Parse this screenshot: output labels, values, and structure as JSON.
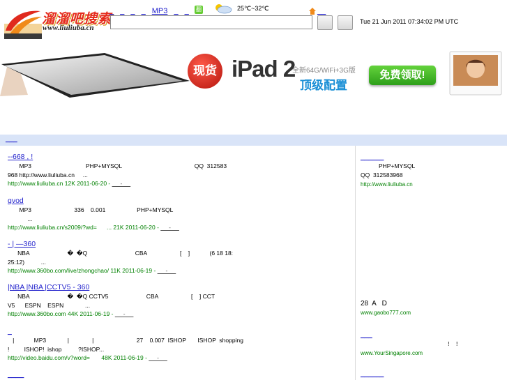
{
  "header": {
    "logo_text": "溜溜吧搜索",
    "logo_url": "www.liuliuba.cn",
    "nav": [
      "_",
      "_",
      "_",
      "_",
      "MP3",
      "_",
      "_"
    ],
    "weather_badge": "翻",
    "temperature": "25℃~32℃",
    "home_link": "__",
    "datetime": "Tue 21 Jun 2011 07:34:02 PM UTC",
    "search_value": ""
  },
  "banner": {
    "badge": "现货",
    "product": "iPad 2",
    "spec": "全新64G/WiFi+3G版",
    "tagline": "顶级配置",
    "cta": "免费领取!"
  },
  "result_bar": {
    "link": "___"
  },
  "results": [
    {
      "title": "  --668    ,      !",
      "desc": "       MP3                                 PHP+MYSQL                                            QQ  312583\n968 http://www.liuliuba.cn     ...",
      "url": "http://www.liuliuba.cn 12K 2011-06-20 - ",
      "cache": "__ - __"
    },
    {
      "title": "     qvod",
      "desc": "       MP3                          336    0.001                   PHP+MYSQL\n            ...",
      "url": "http://www.liuliuba.cn/s2009/?wd=      ... 21K 2011-06-20 - ",
      "cache": "__ - __"
    },
    {
      "title": "    -      |     —360    ",
      "desc": "      NBA                       �  �Q                             CBA                    [    ]            (6 18 18:\n25:12)          ...",
      "url": "http://www.360bo.com/live/zhongchao/ 11K 2011-06-19 - ",
      "cache": "__ - __"
    },
    {
      "title": "   |NBA  |NBA    |CCTV5      - 360      ",
      "desc": "      NBA                       �  �Q CCTV5                       CBA                    [    ] CCT\nV5      ESPN    ESPN             ...",
      "url": "http://www.360bo.com 44K 2011-06-19 - ",
      "cache": "__ - __"
    },
    {
      "title": "       _   ",
      "desc": "   |            MP3             |              |                          27    0.007  ISHOP       ISHOP  shopping\n!         ISHOP!  ishop          ?ISHOP...",
      "url": "http://video.baidu.com/v?word=       48K 2011-06-19 - ",
      "cache": "__ - __"
    },
    {
      "title": "       ____           ",
      "desc": "",
      "url": "",
      "cache": ""
    }
  ],
  "ads": [
    {
      "title": "______",
      "desc": "           PHP+MYSQL\nQQ  312583968",
      "url": "http://www.liuliuba.cn"
    },
    {
      "title": "",
      "desc": "28  A   D",
      "url": "www.gaobo777.com"
    },
    {
      "title": "___",
      "desc": "                                                     !    !",
      "url": "www.YourSingapore.com"
    },
    {
      "title": "______",
      "desc": "",
      "url": ""
    }
  ]
}
